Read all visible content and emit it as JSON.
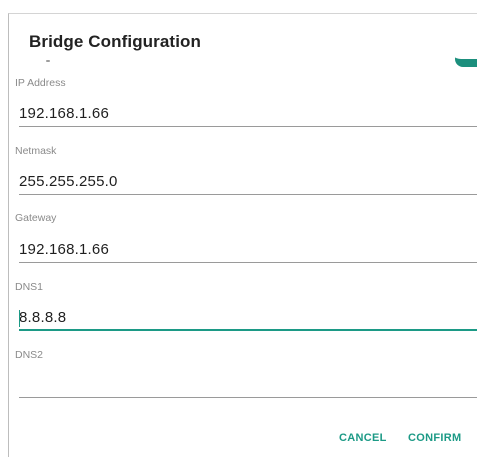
{
  "dialog": {
    "title": "Bridge Configuration",
    "toggle": {
      "state": "on",
      "color": "#1c8f7d"
    },
    "fields": [
      {
        "label": "IP Address",
        "value": "192.168.1.66"
      },
      {
        "label": "Netmask",
        "value": "255.255.255.0"
      },
      {
        "label": "Gateway",
        "value": "192.168.1.66"
      },
      {
        "label": "DNS1",
        "value": "8.8.8.8",
        "focused": true
      },
      {
        "label": "DNS2",
        "value": ""
      }
    ],
    "buttons": {
      "cancel": "CANCEL",
      "confirm": "CONFIRM"
    },
    "accent_color": "#1c9a86"
  }
}
